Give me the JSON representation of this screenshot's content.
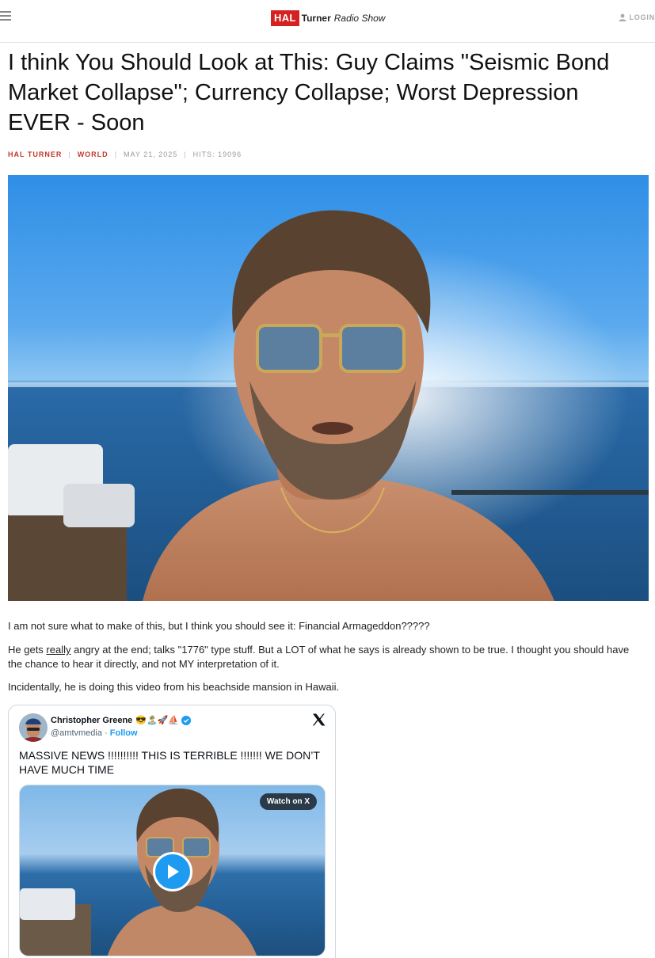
{
  "header": {
    "logo_hal": "HAL",
    "logo_turner": "Turner",
    "logo_radio": "Radio Show",
    "login_label": "LOGIN"
  },
  "article": {
    "title": "I think You Should Look at This: Guy Claims \"Seismic Bond Market Collapse\"; Currency Collapse; Worst Depression EVER - Soon",
    "author": "HAL TURNER",
    "category": "WORLD",
    "date": "MAY 21, 2025",
    "hits": "HITS: 19096",
    "para1": "I am not sure what to make of this, but I think you should see it:  Financial Armageddon?????",
    "para2_pre": "He gets ",
    "para2_underlined": "really",
    "para2_post": " angry at the end; talks \"1776\" type stuff.   But a LOT of what he says is already shown to be true.   I thought you should have the chance to hear it directly, and not MY interpretation of it.",
    "para3": "Incidentally, he is doing this video from his beachside mansion in Hawaii."
  },
  "tweet": {
    "name": "Christopher Greene",
    "name_emojis": "😎🏝️🚀⛵",
    "handle": "@amtvmedia",
    "separator": " · ",
    "follow_label": "Follow",
    "text": "MASSIVE NEWS !!!!!!!!!! THIS IS TERRIBLE !!!!!!! WE DON’T HAVE MUCH TIME",
    "watch_label": "Watch on X"
  },
  "colors": {
    "brand_red": "#d42121",
    "meta_red": "#c0392b",
    "x_blue": "#1d9bf0"
  },
  "icons": [
    "hamburger-menu-icon",
    "user-icon",
    "verified-badge-icon",
    "x-logo-icon",
    "play-icon"
  ]
}
